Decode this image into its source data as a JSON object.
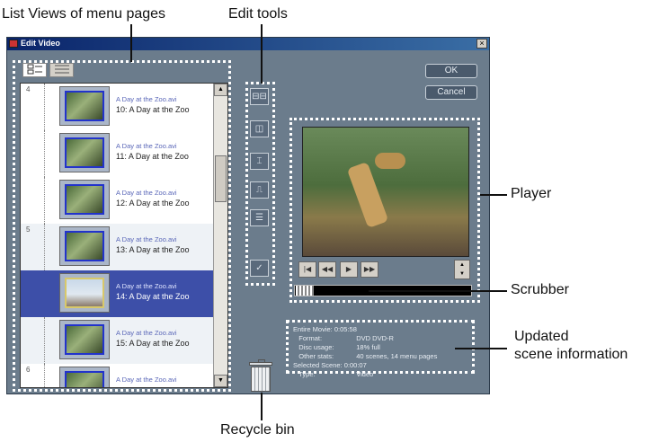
{
  "annotations": {
    "list_views": "List Views of menu pages",
    "edit_tools": "Edit tools",
    "player": "Player",
    "scrubber": "Scrubber",
    "updated_info_line1": "Updated",
    "updated_info_line2": "scene information",
    "recycle_bin": "Recycle bin"
  },
  "window": {
    "title": "Edit Video",
    "close": "×"
  },
  "buttons": {
    "ok": "OK",
    "cancel": "Cancel"
  },
  "list": {
    "rows": [
      {
        "num": "4",
        "file": "A Day at the Zoo.avi",
        "scene": "10:  A Day at the Zoo"
      },
      {
        "num": "",
        "file": "A Day at the Zoo.avi",
        "scene": "11:  A Day at the Zoo"
      },
      {
        "num": "",
        "file": "A Day at the Zoo.avi",
        "scene": "12:  A Day at the Zoo"
      },
      {
        "num": "5",
        "file": "A Day at the Zoo.avi",
        "scene": "13:  A Day at the Zoo"
      },
      {
        "num": "",
        "file": "A Day at the Zoo.avi",
        "scene": "14:  A Day at the Zoo"
      },
      {
        "num": "",
        "file": "A Day at the Zoo.avi",
        "scene": "15:  A Day at the Zoo"
      },
      {
        "num": "6",
        "file": "A Day at the Zoo.avi",
        "scene": ""
      }
    ]
  },
  "info": {
    "entire_movie_label": "Entire Movie:",
    "entire_movie_value": "0:05:58",
    "format_label": "Format:",
    "format_value": "DVD DVD-R",
    "disc_label": "Disc usage:",
    "disc_value": "18% full",
    "other_label": "Other stats:",
    "other_value": "40 scenes, 14 menu pages",
    "selected_label": "Selected Scene:",
    "selected_value": "0:00:07",
    "type_label": "Type:",
    "type_value": "Video"
  },
  "icons": {
    "tabs": [
      "thumbnail-list-icon",
      "text-list-icon"
    ],
    "tools": [
      "combine-scenes-icon",
      "split-scene-icon",
      "split-at-frame-icon",
      "trim-icon",
      "chapter-list-icon",
      "properties-icon"
    ],
    "player": [
      "go-to-start-icon",
      "rewind-icon",
      "play-icon",
      "fast-forward-icon"
    ]
  }
}
